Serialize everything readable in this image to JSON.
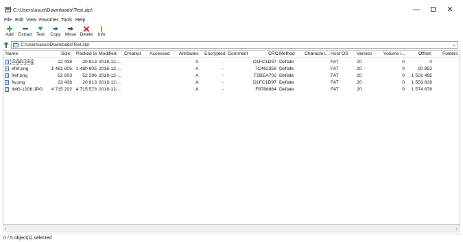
{
  "window": {
    "title": "C:\\Users\\asus\\Downloads\\Test.zip\\",
    "min_glyph": "—",
    "close_glyph": "✕"
  },
  "menu": [
    "File",
    "Edit",
    "View",
    "Favorites",
    "Tools",
    "Help"
  ],
  "toolbar": {
    "add": "Add",
    "extract": "Extract",
    "test": "Test",
    "copy": "Copy",
    "move": "Move",
    "delete": "Delete",
    "info": "Info"
  },
  "colors": {
    "add": "#2e9b2e",
    "extract": "#2b4fa3",
    "test": "#2aa8a0",
    "copy": "#1f5fbf",
    "move": "#1d3f8f",
    "delete": "#c8202a",
    "info": "#8a8a2a"
  },
  "address": {
    "path": "C:\\Users\\asus\\Downloads\\Test.zip\\",
    "dropdown_glyph": "⌄"
  },
  "columns": {
    "name": "Name",
    "size": "Size",
    "packed": "Packed Si",
    "modified": "Modified",
    "created": "Created",
    "accessed": "Accessed",
    "attributes": "Attributes",
    "encrypted": "Encrypted",
    "comment": "Comment",
    "crc": "CRC",
    "method": "Method",
    "characteristics": "Character...",
    "hostos": "Host OS",
    "version": "Version",
    "volume": "Volume I...",
    "offset": "Offset",
    "folders": "Folders"
  },
  "files": [
    {
      "name": "ccgdc.png",
      "size": "22 438",
      "packed": "20 813",
      "modified": "2018-12-...",
      "attributes": "A",
      "encrypted": "-",
      "crc": "D1FC1D97",
      "method": "Deflate",
      "hostos": "FAT",
      "version": "20",
      "volume": "0",
      "offset": "0"
    },
    {
      "name": "efef.png",
      "size": "1 481 605",
      "packed": "1 480 605",
      "modified": "2018-12-...",
      "attributes": "A",
      "encrypted": "-",
      "crc": "7C462358",
      "method": "Deflate",
      "hostos": "FAT",
      "version": "20",
      "volume": "0",
      "offset": "20 852"
    },
    {
      "name": "fref.png",
      "size": "52 603",
      "packed": "52 296",
      "modified": "2018-12-...",
      "attributes": "A",
      "encrypted": "-",
      "crc": "F2BEA702",
      "method": "Deflate",
      "hostos": "FAT",
      "version": "20",
      "volume": "0",
      "offset": "1 501 495"
    },
    {
      "name": "fw.png",
      "size": "22 438",
      "packed": "20 813",
      "modified": "2018-12-...",
      "attributes": "A",
      "encrypted": "-",
      "crc": "D1FC1D97",
      "method": "Deflate",
      "hostos": "FAT",
      "version": "20",
      "volume": "0",
      "offset": "1 553 829"
    },
    {
      "name": "IMG-1208.JPG",
      "size": "4 715 202",
      "packed": "4 715 573",
      "modified": "2018-12-...",
      "attributes": "A",
      "encrypted": "-",
      "crc": "F8788884",
      "method": "Deflate",
      "hostos": "FAT",
      "version": "20",
      "volume": "0",
      "offset": "1 574 678"
    }
  ],
  "scroll": {
    "left_glyph": "‹",
    "right_glyph": "›"
  },
  "status": "0 / 5 object(s) selected"
}
